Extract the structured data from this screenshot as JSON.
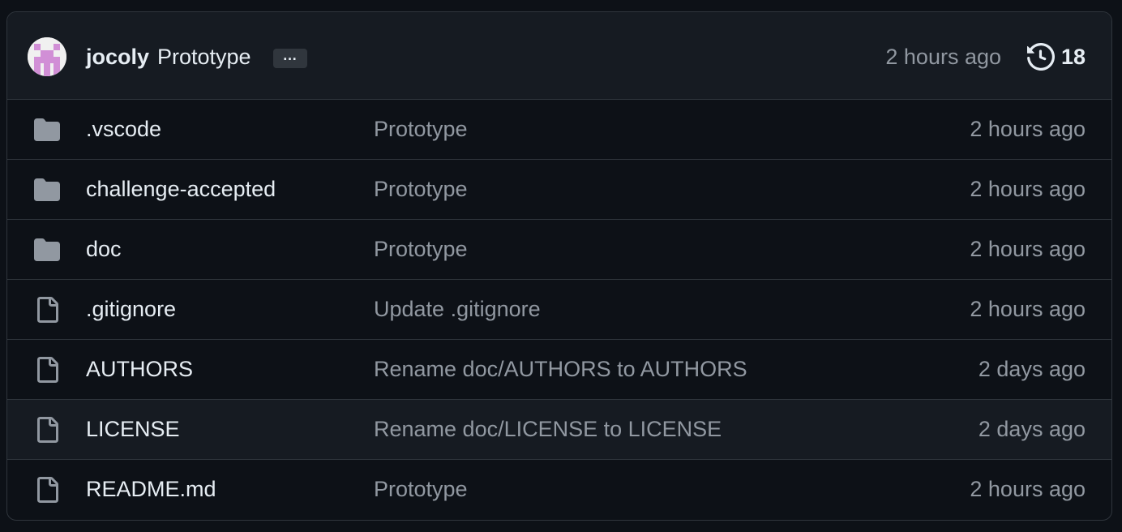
{
  "latest_commit": {
    "author": "jocoly",
    "message": "Prototype",
    "more_label": "…",
    "time": "2 hours ago",
    "history_icon": "history-icon",
    "history_count": "18"
  },
  "files": [
    {
      "type": "folder",
      "icon": "folder-icon",
      "name": ".vscode",
      "message": "Prototype",
      "time": "2 hours ago"
    },
    {
      "type": "folder",
      "icon": "folder-icon",
      "name": "challenge-accepted",
      "message": "Prototype",
      "time": "2 hours ago"
    },
    {
      "type": "folder",
      "icon": "folder-icon",
      "name": "doc",
      "message": "Prototype",
      "time": "2 hours ago"
    },
    {
      "type": "file",
      "icon": "file-icon",
      "name": ".gitignore",
      "message": "Update .gitignore",
      "time": "2 hours ago"
    },
    {
      "type": "file",
      "icon": "file-icon",
      "name": "AUTHORS",
      "message": "Rename doc/AUTHORS to AUTHORS",
      "time": "2 days ago"
    },
    {
      "type": "file",
      "icon": "file-icon",
      "name": "LICENSE",
      "message": "Rename doc/LICENSE to LICENSE",
      "time": "2 days ago"
    },
    {
      "type": "file",
      "icon": "file-icon",
      "name": "README.md",
      "message": "Prototype",
      "time": "2 hours ago"
    }
  ],
  "colors": {
    "background": "#0d1117",
    "header_background": "#161b22",
    "border": "#30363d",
    "text_primary": "#e6edf3",
    "text_muted": "#9198a1",
    "icon": "#9198a1",
    "avatar_accent": "#d18fd6"
  }
}
